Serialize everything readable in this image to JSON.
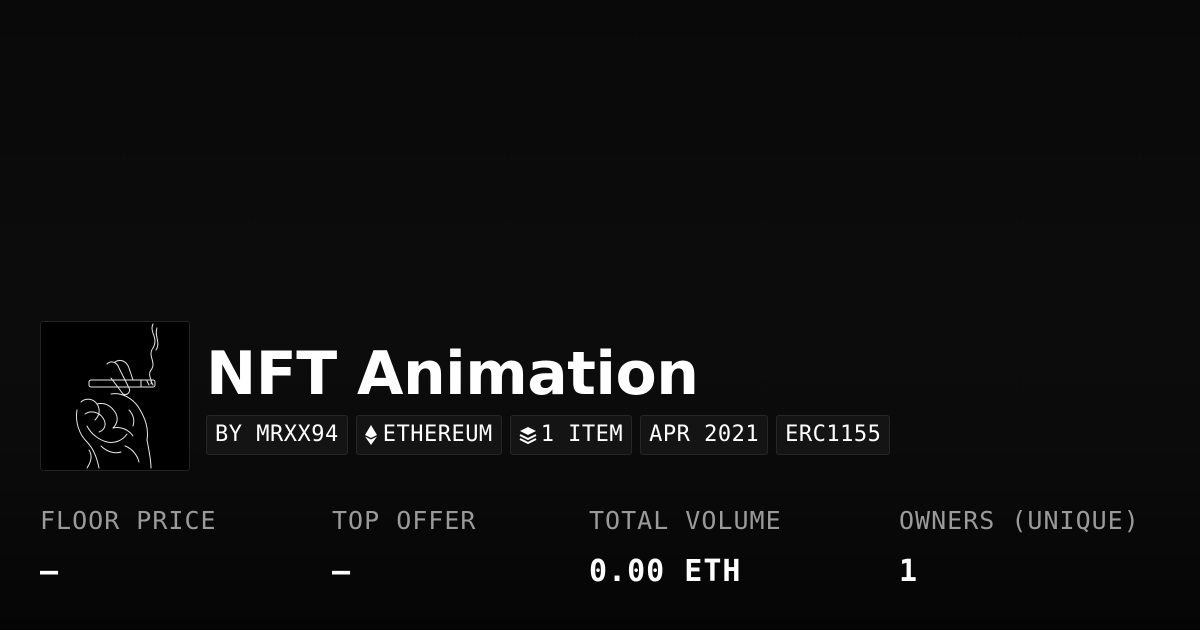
{
  "collection": {
    "title": "NFT Animation",
    "thumbnail_icon": "smoking-hand-line-art-icon"
  },
  "tags": {
    "creator": "BY MRXX94",
    "chain": "ETHEREUM",
    "chain_icon": "ethereum-icon",
    "items": "1 ITEM",
    "items_icon": "layers-icon",
    "date": "APR 2021",
    "standard": "ERC1155"
  },
  "stats": [
    {
      "label": "FLOOR PRICE",
      "value": "—"
    },
    {
      "label": "TOP OFFER",
      "value": "—"
    },
    {
      "label": "TOTAL VOLUME",
      "value": "0.00 ETH"
    },
    {
      "label": "OWNERS (UNIQUE)",
      "value": "1"
    }
  ],
  "colors": {
    "background": "#0a0a0a",
    "text": "#ffffff",
    "muted": "#9a9a9a",
    "tag_background": "#141414",
    "tag_border": "#262626"
  }
}
